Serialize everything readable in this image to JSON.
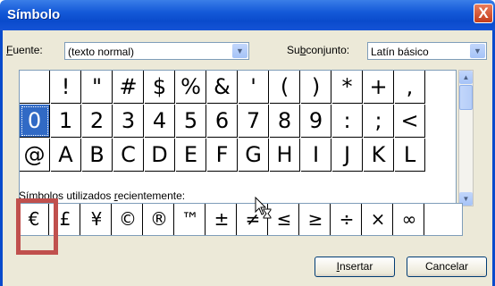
{
  "window": {
    "title": "Símbolo",
    "close_label": "X"
  },
  "font": {
    "label_pre": "",
    "label_key": "F",
    "label_post": "uente:",
    "value": "(texto normal)"
  },
  "subset": {
    "label_pre": "Su",
    "label_key": "b",
    "label_post": "conjunto:",
    "value": "Latín básico"
  },
  "grid": {
    "rows": [
      [
        "",
        "!",
        "\"",
        "#",
        "$",
        "%",
        "&",
        "'",
        "(",
        ")",
        "*",
        "+",
        ","
      ],
      [
        "0",
        "1",
        "2",
        "3",
        "4",
        "5",
        "6",
        "7",
        "8",
        "9",
        ":",
        ";",
        "<"
      ],
      [
        "@",
        "A",
        "B",
        "C",
        "D",
        "E",
        "F",
        "G",
        "H",
        "I",
        "J",
        "K",
        "L"
      ]
    ],
    "selected": "0"
  },
  "recent": {
    "label_pre": "Símbolos utilizados ",
    "label_key": "r",
    "label_post": "ecientemente:",
    "symbols": [
      "€",
      "£",
      "¥",
      "©",
      "®",
      "™",
      "±",
      "≠",
      "≤",
      "≥",
      "÷",
      "×",
      "∞"
    ]
  },
  "buttons": {
    "insert_key": "I",
    "insert_rest": "nsertar",
    "cancel": "Cancelar"
  },
  "icons": {
    "scroll_up": "chevron-up-icon",
    "scroll_down": "chevron-down-icon",
    "cursor": "busy-cursor-icon"
  }
}
